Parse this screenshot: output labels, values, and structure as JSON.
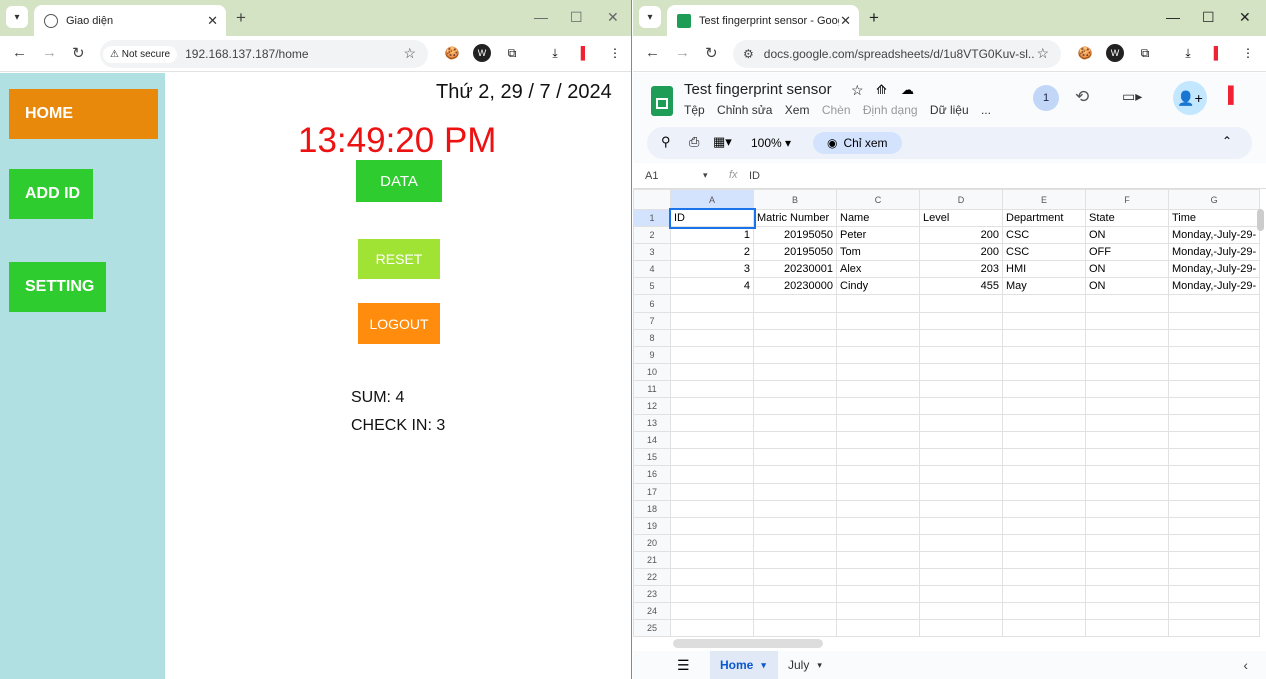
{
  "left_browser": {
    "tab_title": "Giao diện",
    "security_label": "Not secure",
    "url": "192.168.137.187/home"
  },
  "left_page": {
    "date": "Thứ 2, 29 / 7 / 2024",
    "time": "13:49:20 PM",
    "nav": [
      "HOME",
      "ADD ID",
      "SETTING"
    ],
    "data_button": "DATA",
    "reset_button": "RESET",
    "logout_button": "LOGOUT",
    "sum": "SUM: 4",
    "checkin": "CHECK IN: 3",
    "colors": {
      "sidebar": "#b1e0e3",
      "home": "#e8890c",
      "green": "#2fcc2f",
      "reset": "#a1e335",
      "logout": "#ff8c0c",
      "time": "#ee1111"
    }
  },
  "right_browser": {
    "tab_title": "Test fingerprint sensor - Google",
    "url": "docs.google.com/spreadsheets/d/1u8VTG0Kuv-sl..."
  },
  "sheet": {
    "title": "Test fingerprint sensor",
    "menu": [
      "Tệp",
      "Chỉnh sửa",
      "Xem",
      "Chèn",
      "Định dạng",
      "Dữ liệu",
      "..."
    ],
    "viewer_count": "1",
    "zoom": "100%",
    "mode": "Chỉ xem",
    "cell_ref": "A1",
    "formula_icon": "fx",
    "formula": "ID",
    "columns": [
      "A",
      "B",
      "C",
      "D",
      "E",
      "F",
      "G"
    ],
    "headers": [
      "ID",
      "Matric Number",
      "Name",
      "Level",
      "Department",
      "State",
      "Time"
    ],
    "rows": [
      [
        "1",
        "20195050",
        "Peter",
        "200",
        "CSC",
        "ON",
        "Monday,-July-29-"
      ],
      [
        "2",
        "20195050",
        "Tom",
        "200",
        "CSC",
        "OFF",
        "Monday,-July-29-"
      ],
      [
        "3",
        "20230001",
        "Alex",
        "203",
        "HMI",
        "ON",
        "Monday,-July-29-"
      ],
      [
        "4",
        "20230000",
        "Cindy",
        "455",
        "May",
        "ON",
        "Monday,-July-29-"
      ]
    ],
    "row_count": 25,
    "sheet_tabs": [
      "Home",
      "July"
    ]
  }
}
